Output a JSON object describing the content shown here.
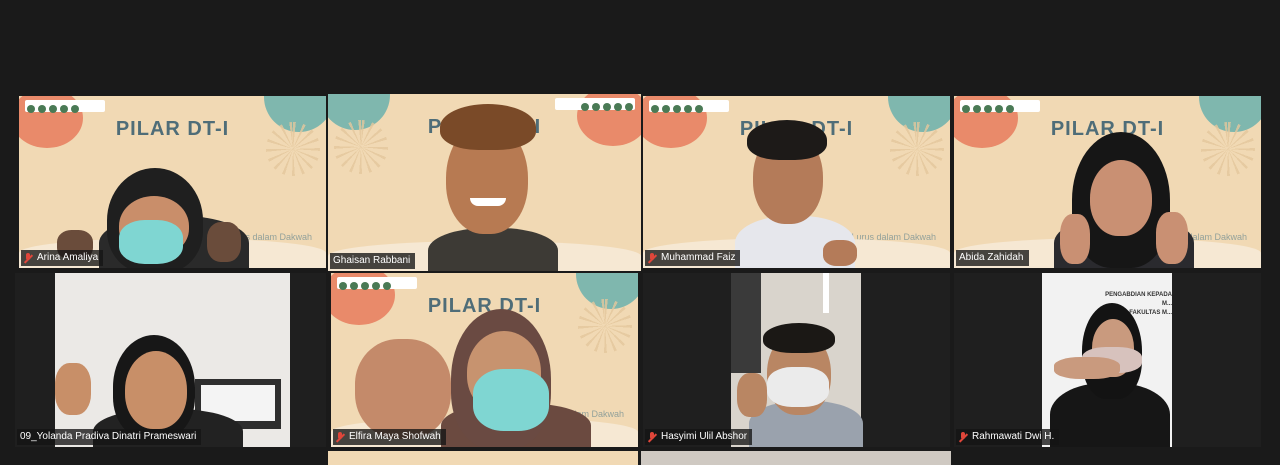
{
  "meeting": {
    "slide_title": "PILAR DT-I",
    "slide_subtitle": "Kader ... berjiwa Qur'ani, Lurus ... Inovatif dalam Dakwah",
    "slide_subtitle_short": "Qur'ani, Lurus\ndalam Dakwah",
    "banner_text": "PENGABDIAN KEPADA M...\nFAKULTAS M..."
  },
  "participants": [
    {
      "name": "Arina Amaliya",
      "muted": true
    },
    {
      "name": "Ghaisan Rabbani",
      "muted": false,
      "active_speaker": true
    },
    {
      "name": "Muhammad Faiz",
      "muted": true
    },
    {
      "name": "Abida Zahidah",
      "muted": false
    },
    {
      "name": "09_Yolanda Pradiva Dinatri Prameswari",
      "muted": false
    },
    {
      "name": "Elfira Maya Shofwah",
      "muted": true
    },
    {
      "name": "Hasyimi Ulil Abshor",
      "muted": true
    },
    {
      "name": "Rahmawati Dwi H.",
      "muted": true
    }
  ],
  "colors": {
    "active_border": "#c8d96a",
    "mic_muted": "#e0463a",
    "slide_bg": "#f1d9b4",
    "title": "#4f6d78"
  },
  "icons": [
    "mic-muted-icon"
  ]
}
